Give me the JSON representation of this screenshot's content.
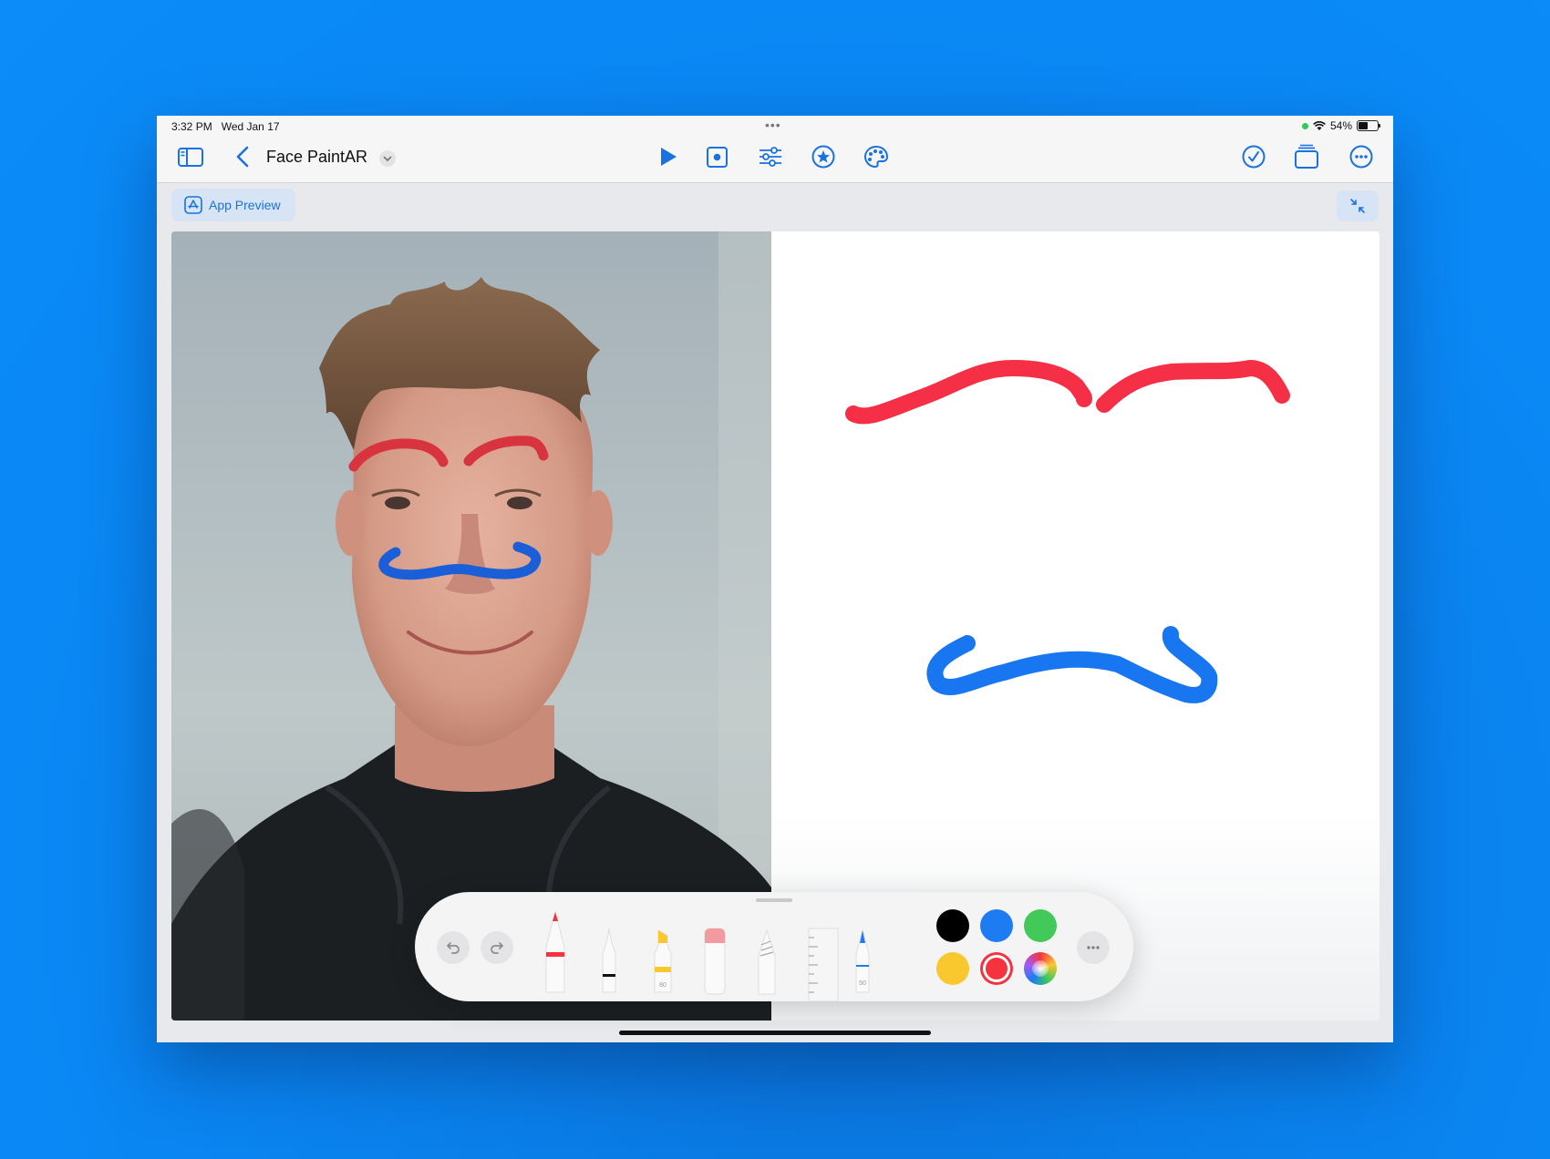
{
  "status_bar": {
    "time": "3:32 PM",
    "date": "Wed Jan 17",
    "battery": "54%"
  },
  "toolbar": {
    "title": "Face PaintAR"
  },
  "preview": {
    "label": "App Preview"
  },
  "palette": {
    "colors": [
      "#000000",
      "#1d7cf2",
      "#43c95a",
      "#f9c72e",
      "#f5333f"
    ],
    "selected_color": "#f5333f",
    "tool_labels": {
      "marker": "80",
      "pen": "50"
    }
  },
  "accent_colors": {
    "tint": "#1a72e0",
    "eyebrows": "#f52f45",
    "mustache": "#1776f0"
  }
}
